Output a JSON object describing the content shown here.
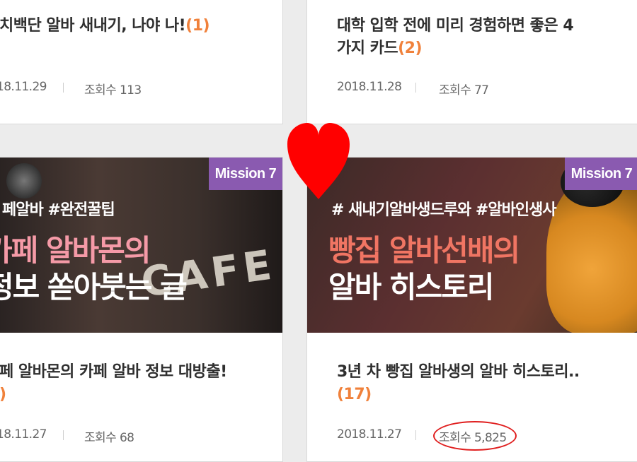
{
  "cards": [
    {
      "title": "치백단 알바 새내기, 나야 나!",
      "count": "(1)",
      "date": "18.11.29",
      "views_label": "조회수",
      "views": "113"
    },
    {
      "title_line1": "대학 입학 전에 미리 경험하면 좋은 4",
      "title_line2": "가지 카드",
      "count": "(2)",
      "date": "2018.11.28",
      "views_label": "조회수",
      "views": "77"
    },
    {
      "badge": "Mission 7",
      "hashtags": "페알바 #완전꿀팁",
      "headline1": "카페 알바몬의",
      "headline2": "정보 쏟아붓는 글",
      "sign": "CAFE",
      "title": "페 알바몬의 카페 알바 정보 대방출!",
      "count": ")",
      "date": "18.11.27",
      "views_label": "조회수",
      "views": "68"
    },
    {
      "badge": "Mission 7",
      "hashtags": "# 새내기알바생드루와 #알바인생사",
      "headline1": "빵집 알바선배의",
      "headline2": "알바 히스토리",
      "title": "3년 차 빵집 알바생의 알바 히스토리..",
      "count": "(17)",
      "date": "2018.11.27",
      "views_label": "조회수",
      "views": "5,825"
    }
  ],
  "colors": {
    "count_accent": "#f0813b",
    "mission_badge": "#8a5ab0",
    "annotation_red": "#e02020"
  },
  "annotations": [
    "heart-icon",
    "red-circle-highlight"
  ]
}
